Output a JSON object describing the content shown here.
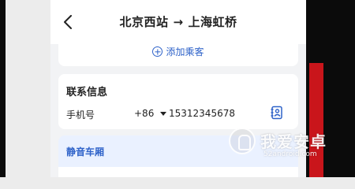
{
  "header": {
    "from_station": "北京西站",
    "arrow": "→",
    "to_station": "上海虹桥"
  },
  "passenger": {
    "add_label": "添加乘客"
  },
  "contact": {
    "section_title": "联系信息",
    "phone_label": "手机号",
    "country_code": "+86",
    "phone_number": "15312345678"
  },
  "seat_preference": {
    "quiet_car_label": "静音车厢"
  },
  "watermark": {
    "brand_text": "我爱安卓",
    "domain": "52android.com"
  },
  "colors": {
    "accent": "#2f63c9",
    "quiet_bg": "#eaf1ff",
    "page_bg": "#f2f3f5",
    "bezel": "#0b0b0b",
    "side_red": "#c9151b"
  },
  "icons": {
    "back": "chevron-left-icon",
    "add": "plus-circle-icon",
    "dropdown": "caret-down-icon",
    "contacts": "contact-book-icon",
    "logo": "android-logo-icon"
  }
}
